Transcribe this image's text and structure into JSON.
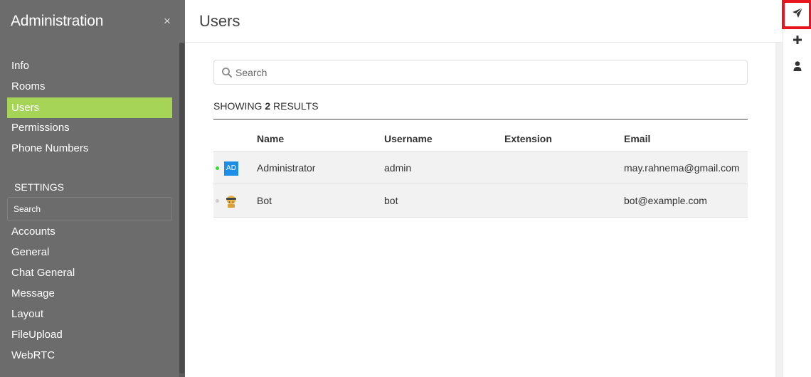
{
  "sidebar": {
    "title": "Administration",
    "close_label": "×",
    "nav": [
      {
        "label": "Info",
        "active": false
      },
      {
        "label": "Rooms",
        "active": false
      },
      {
        "label": "Users",
        "active": true
      },
      {
        "label": "Permissions",
        "active": false
      },
      {
        "label": "Phone Numbers",
        "active": false
      }
    ],
    "settings_heading": "SETTINGS",
    "settings_search_placeholder": "Search",
    "settings": [
      {
        "label": "Accounts"
      },
      {
        "label": "General"
      },
      {
        "label": "Chat General"
      },
      {
        "label": "Message"
      },
      {
        "label": "Layout"
      },
      {
        "label": "FileUpload"
      },
      {
        "label": "WebRTC"
      }
    ]
  },
  "main": {
    "title": "Users",
    "search_placeholder": "Search",
    "results": {
      "prefix": "SHOWING",
      "count": "2",
      "suffix": "RESULTS"
    },
    "columns": {
      "name": "Name",
      "username": "Username",
      "extension": "Extension",
      "email": "Email"
    },
    "rows": [
      {
        "avatar_text": "AD",
        "status_color": "#2de02d",
        "name": "Administrator",
        "username": "admin",
        "extension": "",
        "email": "may.rahnema@gmail.com"
      },
      {
        "avatar_icon": "bot-avatar-icon",
        "status_color": "#cccccc",
        "name": "Bot",
        "username": "bot",
        "extension": "",
        "email": "bot@example.com"
      }
    ]
  },
  "rail": {
    "icons": [
      "send-icon",
      "plus-icon",
      "user-icon"
    ]
  },
  "colors": {
    "sidebar_bg": "#6c6c6c",
    "active_nav": "#a5d457",
    "avatar_ad": "#1d8ee8",
    "highlight": "#e8141f"
  }
}
